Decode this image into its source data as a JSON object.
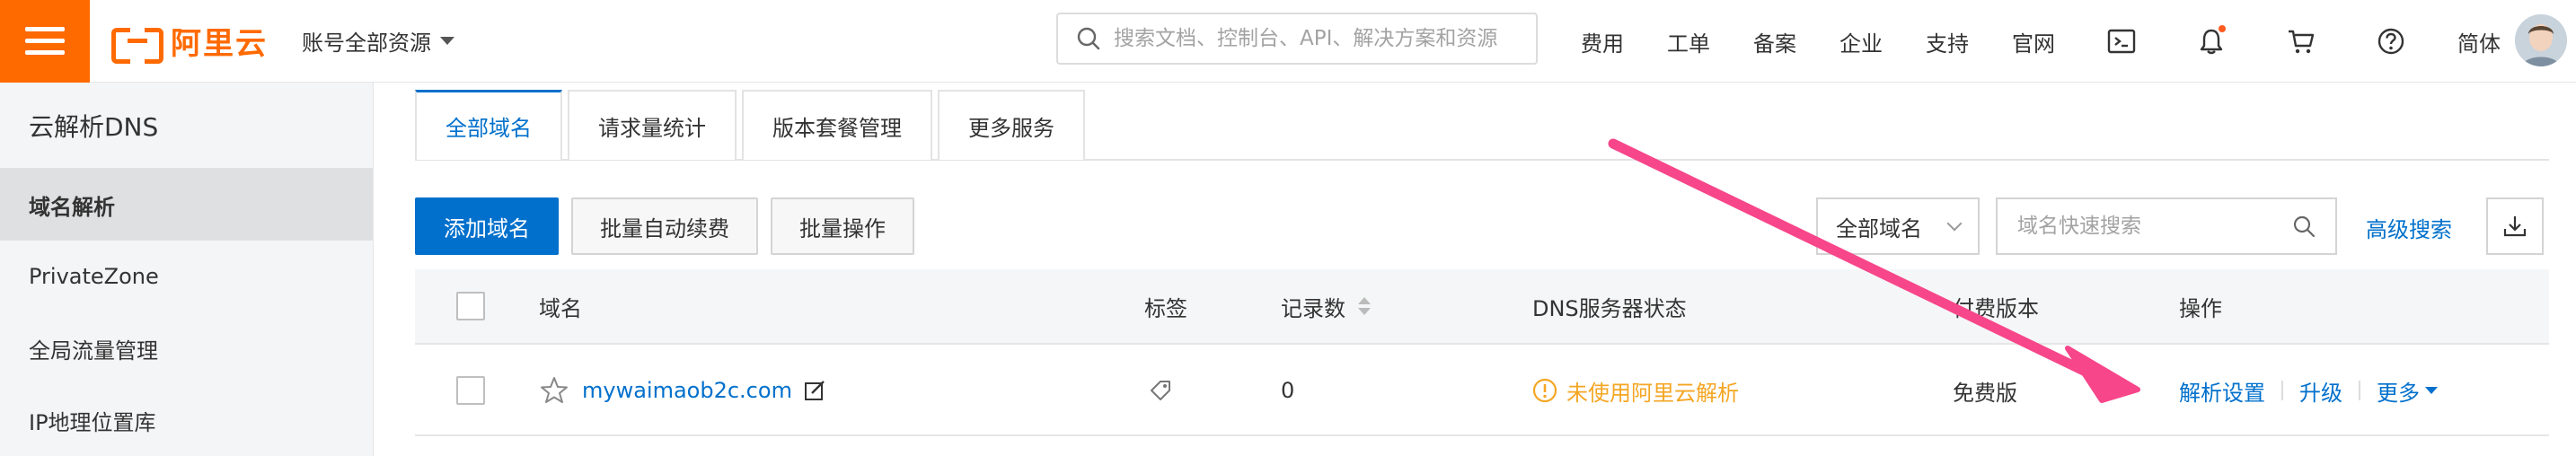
{
  "header": {
    "logo_text": "阿里云",
    "account_label": "账号全部资源",
    "search_placeholder": "搜索文档、控制台、API、解决方案和资源",
    "nav": [
      "费用",
      "工单",
      "备案",
      "企业",
      "支持",
      "官网"
    ],
    "language": "简体",
    "icons": [
      "terminal-icon",
      "bell-icon",
      "cart-icon",
      "help-icon"
    ],
    "accent_color": "#ff6a00"
  },
  "sidebar": {
    "title": "云解析DNS",
    "items": [
      {
        "label": "域名解析",
        "active": true
      },
      {
        "label": "PrivateZone",
        "active": false
      },
      {
        "label": "全局流量管理",
        "active": false
      },
      {
        "label": "IP地理位置库",
        "active": false
      }
    ]
  },
  "tabs": [
    {
      "label": "全部域名",
      "active": true
    },
    {
      "label": "请求量统计",
      "active": false
    },
    {
      "label": "版本套餐管理",
      "active": false
    },
    {
      "label": "更多服务",
      "active": false
    }
  ],
  "toolbar": {
    "add_label": "添加域名",
    "auto_renew_label": "批量自动续费",
    "batch_label": "批量操作",
    "filter_value": "全部域名",
    "quick_search_placeholder": "域名快速搜索",
    "advanced_search": "高级搜索"
  },
  "table": {
    "columns": {
      "domain": "域名",
      "tag": "标签",
      "records": "记录数",
      "dns_status": "DNS服务器状态",
      "version": "付费版本",
      "ops": "操作"
    },
    "rows": [
      {
        "domain": "mywaimaob2c.com",
        "records": "0",
        "dns_status": "未使用阿里云解析",
        "version": "免费版",
        "ops": [
          "解析设置",
          "升级",
          "更多"
        ]
      }
    ]
  },
  "colors": {
    "primary": "#0070cc",
    "warning": "#f5a623",
    "annotation_arrow": "#f7468a"
  }
}
